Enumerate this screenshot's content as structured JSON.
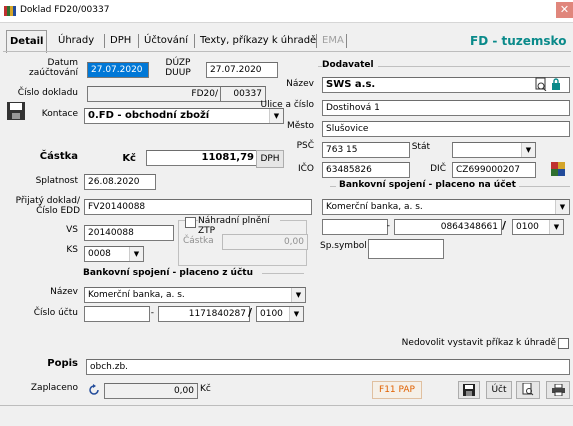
{
  "window": {
    "title": "Doklad FD20/00337",
    "close_glyph": "✕"
  },
  "tabs": [
    {
      "label": "Detail",
      "active": true
    },
    {
      "label": "Úhrady"
    },
    {
      "label": "DPH"
    },
    {
      "label": "Účtování"
    },
    {
      "label": "Texty, příkazy k úhradě"
    },
    {
      "label": "EMA",
      "disabled": true
    }
  ],
  "header_right": "FD - tuzemsko",
  "left": {
    "datum_label": "Datum\nzaúčtování",
    "datum_value": "27.07.2020",
    "duzp_label": "DÚZP\nDUUP",
    "duzp_value": "27.07.2020",
    "cislo_label": "Číslo dokladu",
    "cislo_prefix": "FD20/",
    "cislo_value": "00337",
    "kontace_label": "Kontace",
    "kontace_value": "0.FD - obchodní zboží",
    "castka_label": "Částka",
    "currency_label": "Kč",
    "castka_value": "11081,79",
    "dph_button": "DPH",
    "splatnost_label": "Splatnost",
    "splatnost_value": "26.08.2020",
    "prijaty_label": "Přijatý doklad/\nČíslo EDD",
    "prijaty_value": "FV20140088",
    "vs_label": "VS",
    "vs_value": "20140088",
    "ks_label": "KS",
    "ks_value": "0008",
    "nahradni_label": "Náhradní plnění ZTP",
    "nahradni_castka_label": "Částka",
    "nahradni_castka_value": "0,00"
  },
  "dodavatel": {
    "group_label": "Dodavatel",
    "nazev_label": "Název",
    "nazev_value": "SWS a.s.",
    "ulice_label": "Ulice a číslo",
    "ulice_value": "Dostihová 1",
    "mesto_label": "Město",
    "mesto_value": "Slušovice",
    "psc_label": "PSČ",
    "psc_value": "763 15",
    "stat_label": "Stát",
    "stat_value": "",
    "ico_label": "IČO",
    "ico_value": "63485826",
    "dic_label": "DIČ",
    "dic_value": "CZ699000207"
  },
  "bank_to": {
    "group_label": "Bankovní spojení - placeno na účet",
    "banka_value": "Komerční banka, a. s.",
    "prefix_value": "",
    "cislo_value": "0864348661",
    "kod_value": "0100",
    "spsymbol_label": "Sp.symbol",
    "spsymbol_value": ""
  },
  "bank_from": {
    "group_label": "Bankovní spojení - placeno z účtu",
    "nazev_label": "Název",
    "nazev_value": "Komerční banka, a. s.",
    "cislo_label": "Číslo účtu",
    "prefix_value": "",
    "cislo_value": "1171840287",
    "kod_value": "0100"
  },
  "nedovolit_label": "Nedovolit vystavit příkaz k úhradě",
  "popis_label": "Popis",
  "popis_value": "obch.zb.",
  "zaplaceno_label": "Zaplaceno",
  "zaplaceno_value": "0,00",
  "zaplaceno_currency": "Kč",
  "f11_button": "F11 PAP",
  "uct_button": "Účt",
  "slash": "/",
  "dash": "-",
  "dropdown_glyph": "▼",
  "colors": {
    "accent": "#0a8a8a",
    "selection": "#0078d7",
    "f11": "#e06000"
  }
}
